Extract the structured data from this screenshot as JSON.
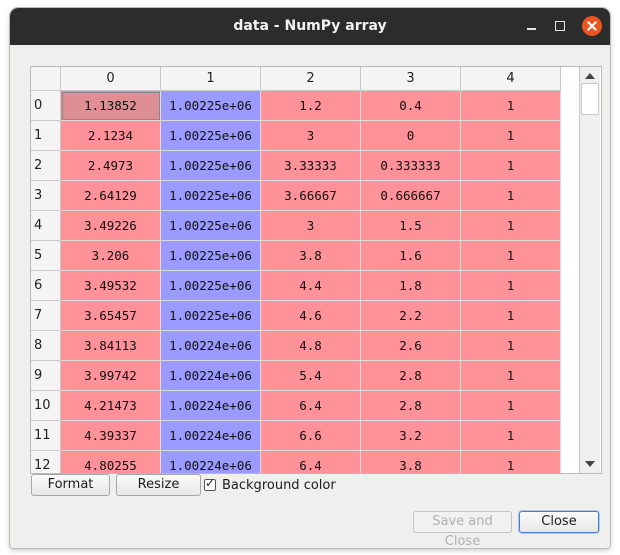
{
  "window": {
    "title": "data - NumPy array"
  },
  "table": {
    "column_headers": [
      "0",
      "1",
      "2",
      "3",
      "4"
    ],
    "row_headers": [
      "0",
      "1",
      "2",
      "3",
      "4",
      "5",
      "6",
      "7",
      "8",
      "9",
      "10",
      "11",
      "12"
    ],
    "rows": [
      [
        "1.13852",
        "1.00225e+06",
        "1.2",
        "0.4",
        "1"
      ],
      [
        "2.1234",
        "1.00225e+06",
        "3",
        "0",
        "1"
      ],
      [
        "2.4973",
        "1.00225e+06",
        "3.33333",
        "0.333333",
        "1"
      ],
      [
        "2.64129",
        "1.00225e+06",
        "3.66667",
        "0.666667",
        "1"
      ],
      [
        "3.49226",
        "1.00225e+06",
        "3",
        "1.5",
        "1"
      ],
      [
        "3.206",
        "1.00225e+06",
        "3.8",
        "1.6",
        "1"
      ],
      [
        "3.49532",
        "1.00225e+06",
        "4.4",
        "1.8",
        "1"
      ],
      [
        "3.65457",
        "1.00225e+06",
        "4.6",
        "2.2",
        "1"
      ],
      [
        "3.84113",
        "1.00224e+06",
        "4.8",
        "2.6",
        "1"
      ],
      [
        "3.99742",
        "1.00224e+06",
        "5.4",
        "2.8",
        "1"
      ],
      [
        "4.21473",
        "1.00224e+06",
        "6.4",
        "2.8",
        "1"
      ],
      [
        "4.39337",
        "1.00224e+06",
        "6.6",
        "3.2",
        "1"
      ],
      [
        "4.80255",
        "1.00224e+06",
        "6.4",
        "3.8",
        "1"
      ]
    ],
    "column_colors": [
      "#ff9198",
      "#9b9bff",
      "#ff9198",
      "#ff9198",
      "#ff9198"
    ],
    "selected_cell_color": "#df8f94",
    "selected_cell": {
      "row": 0,
      "col": 0
    }
  },
  "controls": {
    "format_label": "Format",
    "resize_label": "Resize",
    "background_color_label": "Background color",
    "background_color_checked": true
  },
  "footer": {
    "save_label": "Save and Close",
    "close_label": "Close"
  },
  "colors": {
    "titlebar": "#2c2c2c",
    "close_button": "#e95420",
    "window_bg": "#efefee"
  }
}
